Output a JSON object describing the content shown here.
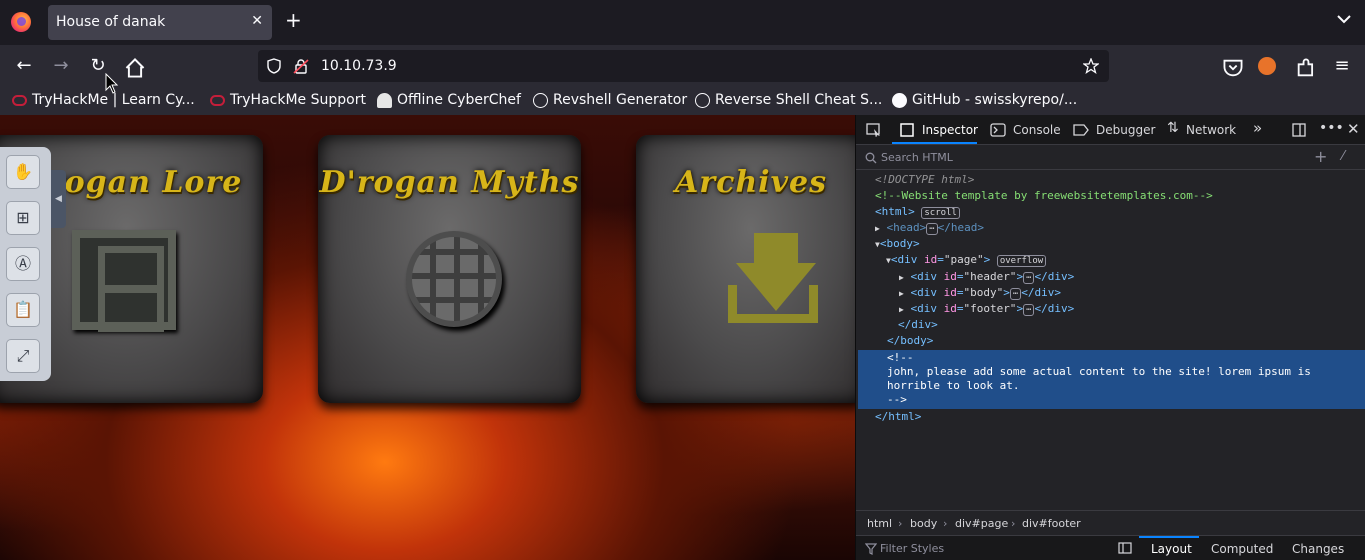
{
  "browser": {
    "tab_title": "House of danak",
    "url": "10.10.73.9",
    "bookmarks": [
      "TryHackMe | Learn Cy...",
      "TryHackMe Support",
      "Offline CyberChef",
      "Revshell Generator",
      "Reverse Shell Cheat S...",
      "GitHub - swisskyrepo/..."
    ]
  },
  "page": {
    "cards": [
      "D'rogan Lore",
      "D'rogan Myths",
      "Archives"
    ]
  },
  "devtools": {
    "tabs": [
      "Inspector",
      "Console",
      "Debugger",
      "Network"
    ],
    "search_placeholder": "Search HTML",
    "tree": {
      "doctype": "<!DOCTYPE html>",
      "comment1": "<!--Website template by freewebsitetemplates.com-->",
      "html_badge": "scroll",
      "page_badge": "overflow",
      "comment_open": "<!--",
      "comment_body1": "john, please add some actual content to the site! lorem ipsum is",
      "comment_body2": "horrible to look at.",
      "comment_close": "-->"
    },
    "breadcrumbs": [
      "html",
      "body",
      "div#page",
      "div#footer"
    ],
    "filter_placeholder": "Filter Styles",
    "bottom_tabs": [
      "Layout",
      "Computed",
      "Changes"
    ]
  }
}
